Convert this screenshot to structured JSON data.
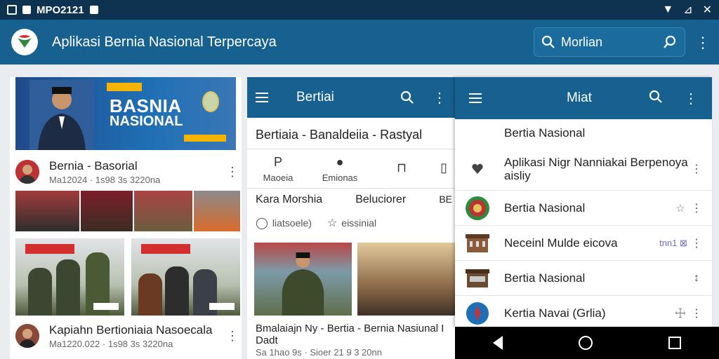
{
  "status_bar": {
    "carrier": "MPO2121",
    "wifi": "▼",
    "signal": "⊿",
    "close": "✕"
  },
  "app_bar": {
    "title": "Aplikasi Bernia Nasional Terpercaya",
    "search_value": "Morlian",
    "more": "⋮"
  },
  "panel1": {
    "banner_title": "BASNIA",
    "banner_sub": "NASIONAL",
    "rows": [
      {
        "title": "Bernia - Basorial",
        "meta": "Ma12024 · 1s98 3s 3220na"
      },
      {
        "title": "Kapiahn Bertioniaia Nasoecala",
        "meta": "Ma1220.022 · 1s98 3s 3220na"
      }
    ]
  },
  "panel2": {
    "title": "Bertiai",
    "headline": "Bertiaia - Banaldeiia - Rastyal",
    "tabs": [
      {
        "icon": "P",
        "label": "Maoeia"
      },
      {
        "icon": "●",
        "label": "Emionas"
      },
      {
        "icon": "⊓",
        "label": ""
      },
      {
        "icon": "▯",
        "label": ""
      }
    ],
    "item_left": "Kara Morshia",
    "item_right": "Beluciorer",
    "item_badge": "BE",
    "meta_left": "liatsoele)",
    "meta_right": "eissinial",
    "caption": "Bmalaiajn Ny - Bertia - Bernia Nasiunal I Dadt",
    "caption_meta": "Sa 1hao 9s · Sioer 21 9 3 20nn"
  },
  "panel3": {
    "title": "Miat",
    "items": [
      {
        "title": "Bertia Nasional",
        "trail": ""
      },
      {
        "title": "Aplikasi Nigr Nanniakai Berpenoya aisliy",
        "trail": ""
      },
      {
        "title": "Bertia Nasional",
        "trail": "☆"
      },
      {
        "title": "Neceinl Mulde eicova",
        "trail": "tnn1 ⊠"
      },
      {
        "title": "Bertia Nasional",
        "trail": ""
      },
      {
        "title": "Kertia Navai (Grlia)",
        "trail": "☩"
      }
    ]
  },
  "colors": {
    "primary": "#16618f",
    "status_bar": "#0e3350",
    "accent_red": "#d32f2f"
  }
}
